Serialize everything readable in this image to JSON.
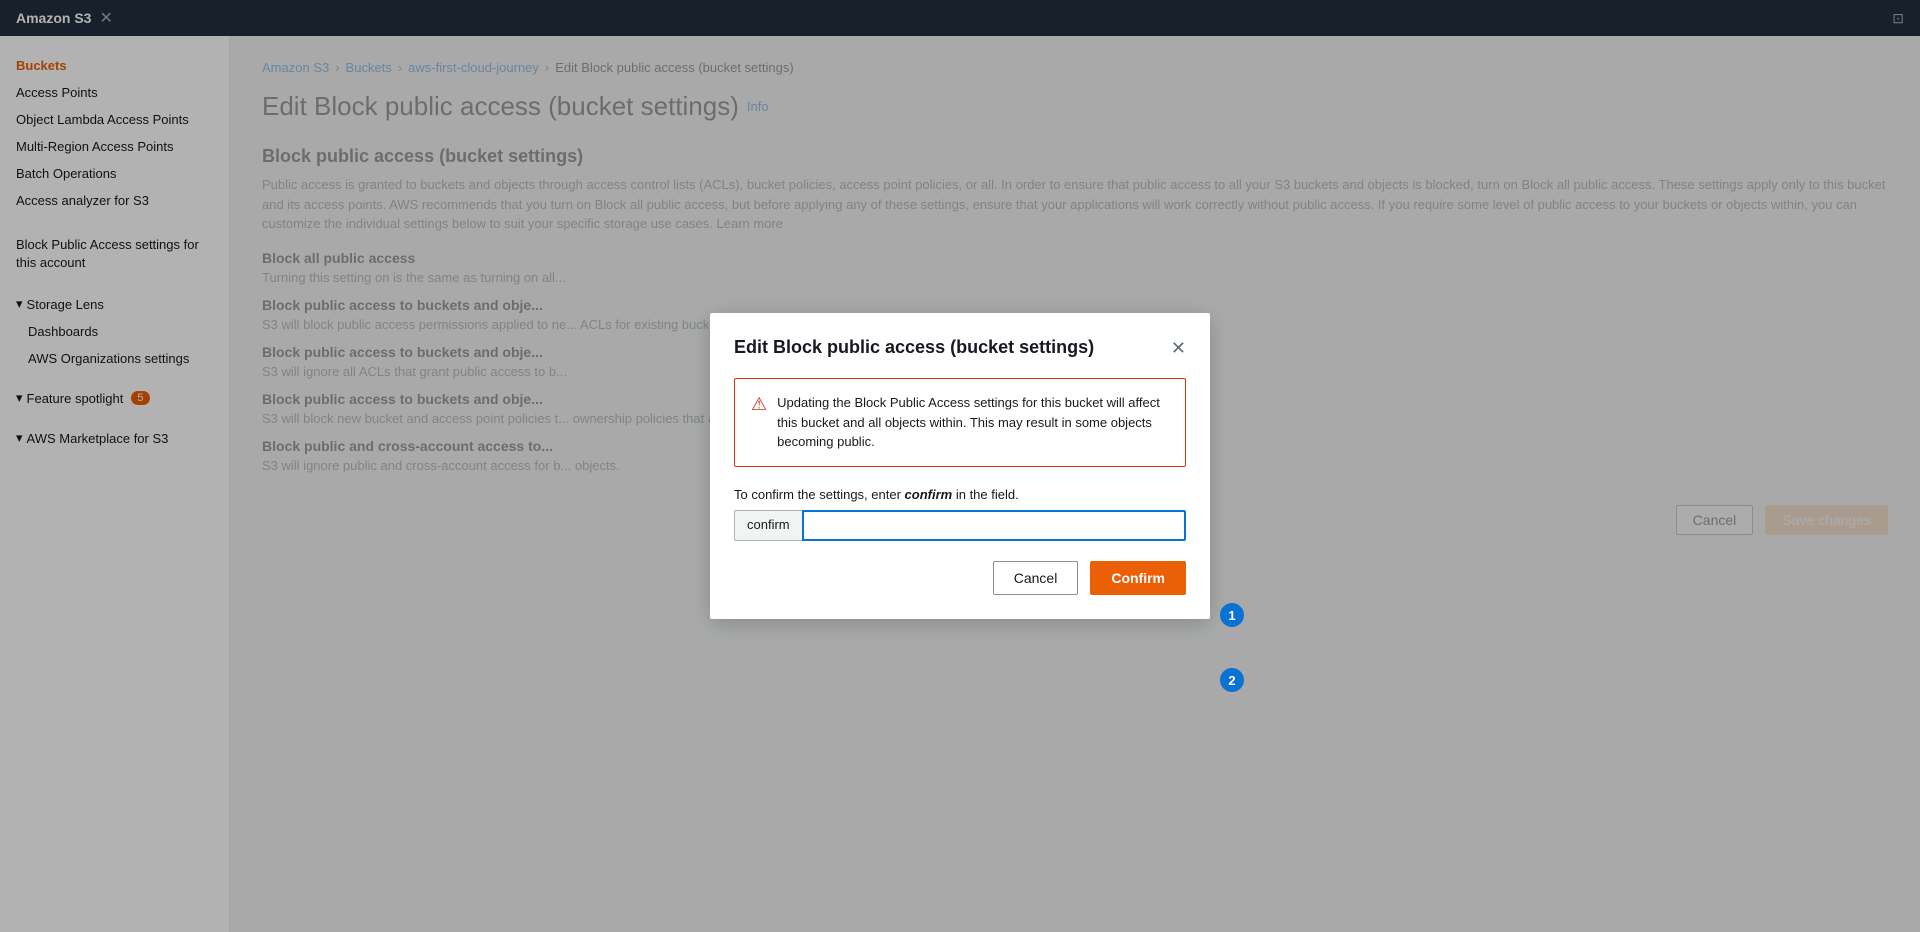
{
  "topbar": {
    "title": "Amazon S3",
    "close_icon": "✕",
    "corner_icon": "⊡"
  },
  "sidebar": {
    "items": [
      {
        "id": "buckets",
        "label": "Buckets",
        "active": true
      },
      {
        "id": "access-points",
        "label": "Access Points",
        "active": false
      },
      {
        "id": "object-lambda",
        "label": "Object Lambda Access Points",
        "active": false
      },
      {
        "id": "multi-region",
        "label": "Multi-Region Access Points",
        "active": false
      },
      {
        "id": "batch-operations",
        "label": "Batch Operations",
        "active": false
      },
      {
        "id": "access-analyzer",
        "label": "Access analyzer for S3",
        "active": false
      }
    ],
    "section2_items": [
      {
        "id": "block-public-access",
        "label": "Block Public Access settings for this account"
      }
    ],
    "storage_lens_label": "Storage Lens",
    "storage_lens_items": [
      {
        "id": "dashboards",
        "label": "Dashboards"
      },
      {
        "id": "org-settings",
        "label": "AWS Organizations settings"
      }
    ],
    "feature_spotlight_label": "Feature spotlight",
    "feature_spotlight_badge": "5",
    "marketplace_label": "AWS Marketplace for S3"
  },
  "breadcrumb": {
    "items": [
      {
        "label": "Amazon S3",
        "link": true
      },
      {
        "label": "Buckets",
        "link": true
      },
      {
        "label": "aws-first-cloud-journey",
        "link": true
      },
      {
        "label": "Edit Block public access (bucket settings)",
        "link": false
      }
    ]
  },
  "page": {
    "title": "Edit Block public access (bucket settings)",
    "info_label": "Info",
    "section_title": "Block public access (bucket settings)",
    "section_desc": "Public access is granted to buckets and objects through access control lists (ACLs), bucket policies, access point policies, or all. In order to ensure that public access to all your S3 buckets and objects is blocked, turn on Block all public access. These settings apply only to this bucket and its access points. AWS recommends that you turn on Block all public access, but before applying any of these settings, ensure that your applications will work correctly without public access. If you require some level of public access to your buckets or objects within, you can customize the individual settings below to suit your specific storage use cases. Learn more",
    "block_all_title": "Block all public access",
    "block_all_desc": "Turning this setting on is the same as turning on all...",
    "subsections": [
      {
        "title": "Block public access to buckets and obje...",
        "desc": "S3 will block public access permissions applied to ne... ACLs for existing buckets and objects. This setting... using ACLs."
      },
      {
        "title": "Block public access to buckets and obje...",
        "desc": "S3 will ignore all ACLs that grant public access to b..."
      },
      {
        "title": "Block public access to buckets and obje...",
        "desc": "S3 will block new bucket and access point policies t... ownership policies that allow public access to S3 re..."
      },
      {
        "title": "Block public and cross-account access to...",
        "desc": "S3 will ignore public and cross-account access for b... objects."
      }
    ],
    "cancel_label": "Cancel",
    "save_label": "Save changes"
  },
  "modal": {
    "title": "Edit Block public access (bucket settings)",
    "close_icon": "✕",
    "warning_text": "Updating the Block Public Access settings for this bucket will affect this bucket and all objects within. This may result in some objects becoming public.",
    "confirm_instruction": "To confirm the settings, enter",
    "confirm_keyword": "confirm",
    "confirm_suffix": "in the field.",
    "input_prefix": "confirm",
    "input_placeholder": "",
    "input_value": "",
    "cancel_label": "Cancel",
    "confirm_label": "Confirm",
    "step1_label": "1",
    "step2_label": "2"
  }
}
